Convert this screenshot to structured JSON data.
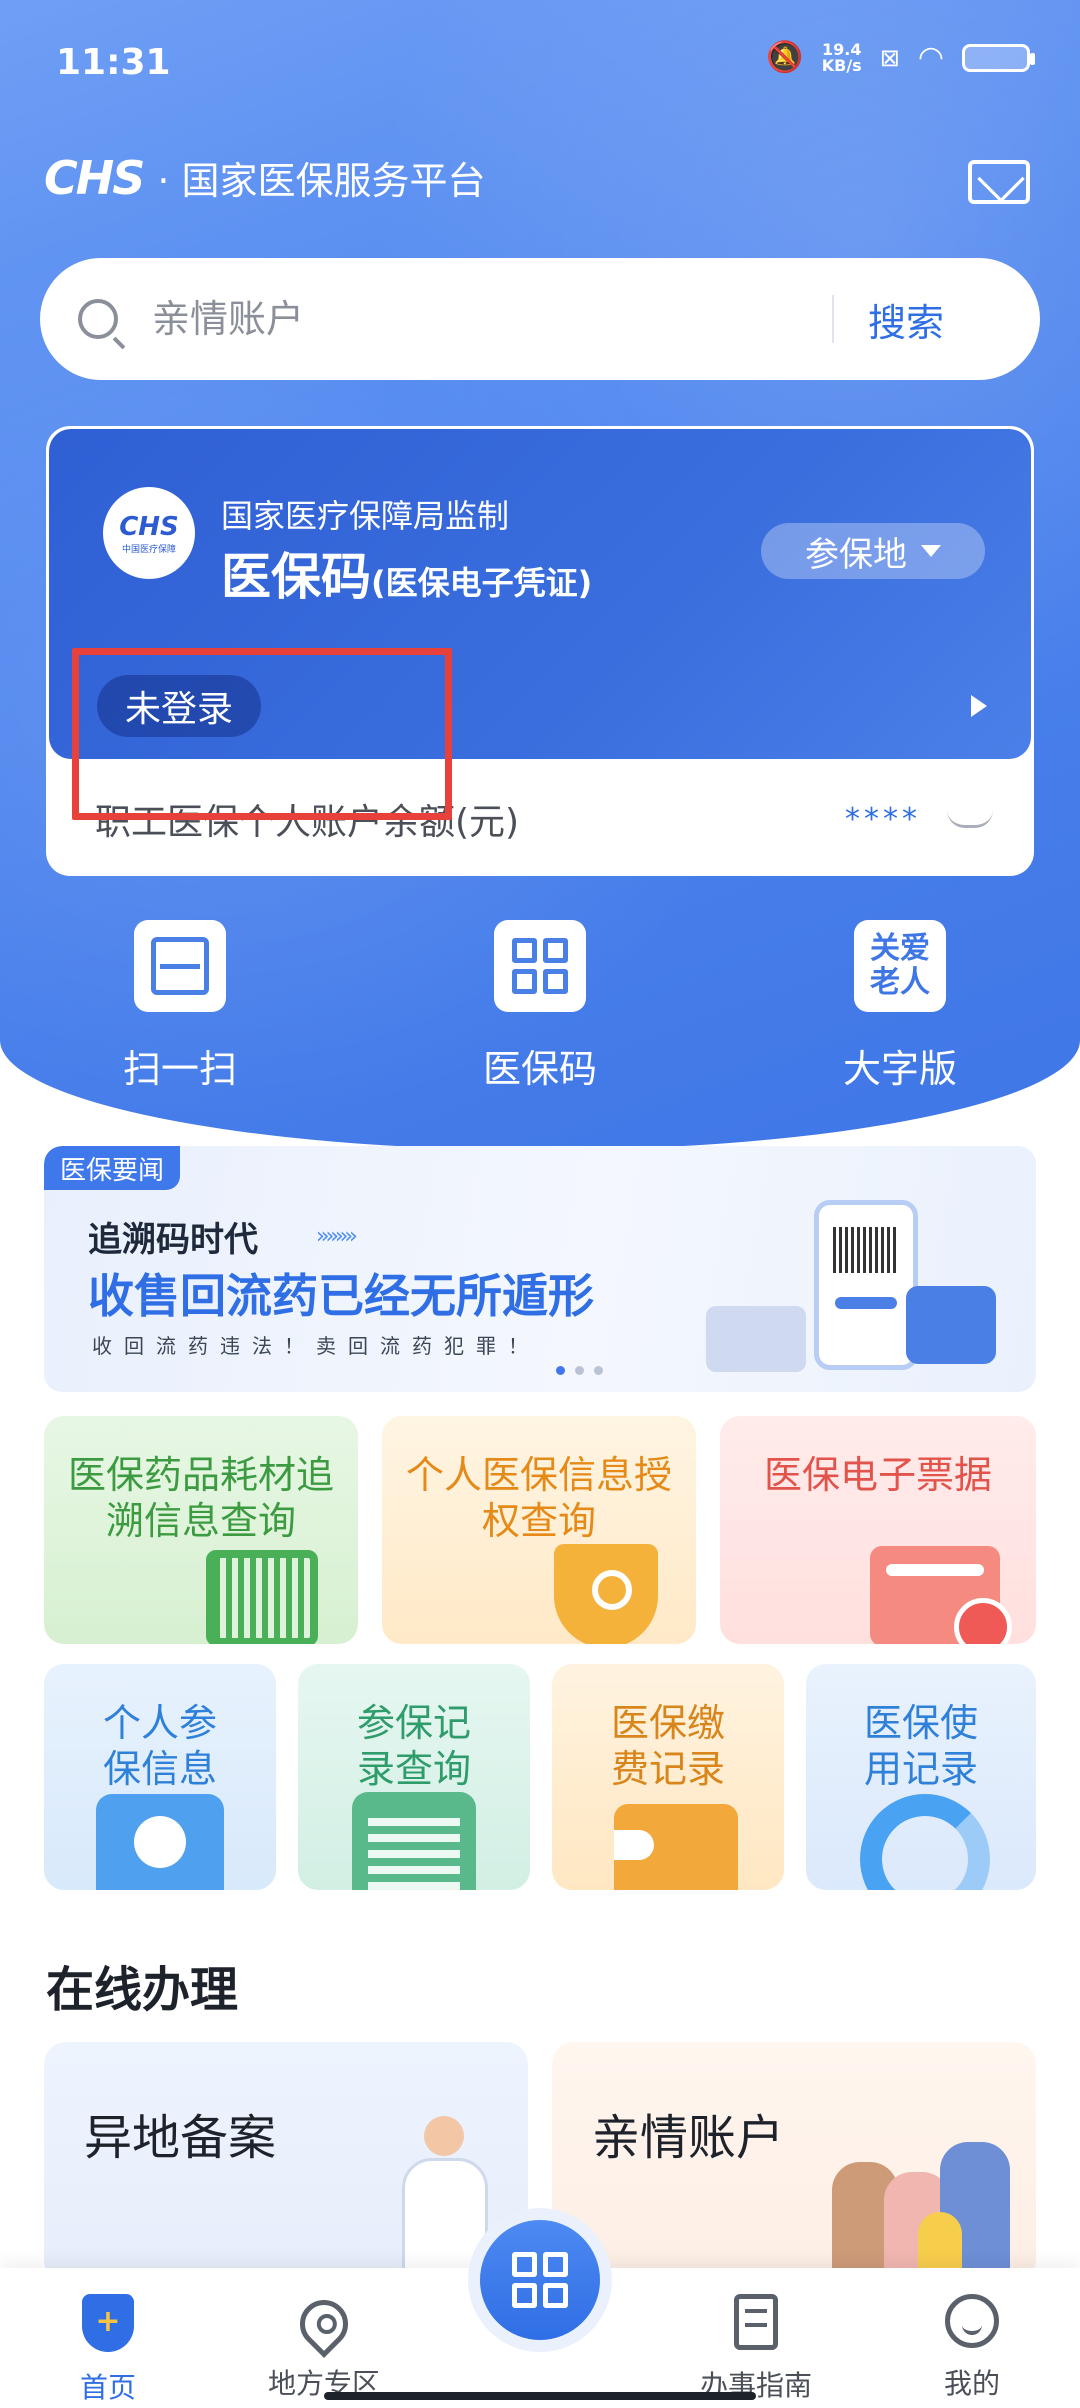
{
  "status_bar": {
    "time": "11:31",
    "network_speed": "19.4",
    "network_unit": "KB/s"
  },
  "header": {
    "logo_text": "CHS",
    "platform_name": "· 国家医保服务平台",
    "mail_icon": "mail-icon"
  },
  "search": {
    "placeholder": "亲情账户",
    "button_label": "搜索"
  },
  "card": {
    "logo_text": "CHS",
    "logo_subtext": "中国医疗保障",
    "supervisor": "国家医疗保障局监制",
    "title": "医保码",
    "title_note": "(医保电子凭证)",
    "location_button": "参保地",
    "login_status": "未登录",
    "balance_label": "职工医保个人账户余额(元)",
    "balance_value": "****"
  },
  "quick_actions": [
    {
      "label": "扫一扫",
      "icon": "scan-icon"
    },
    {
      "label": "医保码",
      "icon": "qr-code-icon"
    },
    {
      "label": "大字版",
      "icon": "elderly-care-icon",
      "icon_text": "关爱老人"
    }
  ],
  "banner": {
    "tag": "医保要闻",
    "line1": "追溯码时代",
    "line2": "收售回流药已经无所遁形",
    "line3": "收回流药违法！卖回流药犯罪！",
    "active_slide": 1,
    "slide_count": 3
  },
  "services_row1": [
    {
      "label": "医保药品耗材追溯信息查询",
      "accent": "#3c9b41"
    },
    {
      "label": "个人医保信息授权查询",
      "accent": "#e58a17"
    },
    {
      "label": "医保电子票据",
      "accent": "#e2534b"
    }
  ],
  "services_row2": [
    {
      "label": "个人参保信息",
      "accent": "#2f80d9"
    },
    {
      "label": "参保记录查询",
      "accent": "#2f9c6b"
    },
    {
      "label": "医保缴费记录",
      "accent": "#d8861c"
    },
    {
      "label": "医保使用记录",
      "accent": "#2f80d9"
    }
  ],
  "online": {
    "title": "在线办理",
    "items": [
      {
        "label": "异地备案"
      },
      {
        "label": "亲情账户"
      }
    ]
  },
  "bottom_nav": [
    {
      "label": "首页",
      "icon": "home-shield-icon",
      "active": true
    },
    {
      "label": "地方专区",
      "icon": "location-pin-icon",
      "active": false
    },
    {
      "label": "",
      "icon": "qr-code-icon",
      "active": false
    },
    {
      "label": "办事指南",
      "icon": "document-icon",
      "active": false
    },
    {
      "label": "我的",
      "icon": "profile-icon",
      "active": false
    }
  ],
  "colors": {
    "brand_blue": "#2f6ee5",
    "highlight_red": "#e8413c"
  }
}
